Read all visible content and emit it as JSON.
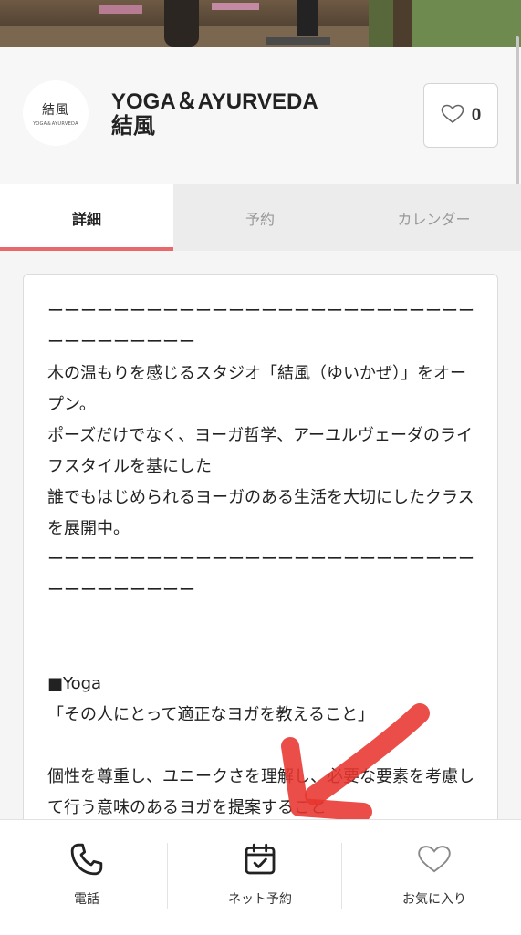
{
  "shop": {
    "logo_main": "結風",
    "logo_sub": "YOGA＆AYURVEDA",
    "title_line1": "YOGA＆AYURVEDA",
    "title_line2": "結風",
    "favorite_count": "0"
  },
  "tabs": [
    {
      "label": "詳細",
      "active": true
    },
    {
      "label": "予約",
      "active": false
    },
    {
      "label": "カレンダー",
      "active": false
    }
  ],
  "description": "ーーーーーーーーーーーーーーーーーーーーーーーーーーーーーーーーーーー\n木の温もりを感じるスタジオ「結風（ゆいかぜ）」をオープン。\nポーズだけでなく、ヨーガ哲学、アーユルヴェーダのライフスタイルを基にした\n誰でもはじめられるヨーガのある生活を大切にしたクラスを展開中。\nーーーーーーーーーーーーーーーーーーーーーーーーーーーーーーーーーーー\n\n\n■Yoga\n「その人にとって適正なヨガを教えること」\n\n個性を尊重し、ユニークさを理解し、必要な要素を考慮して行う意味のあるヨガを提案すること",
  "bottom_bar": {
    "phone_label": "電話",
    "reserve_label": "ネット予約",
    "favorite_label": "お気に入り"
  },
  "icons": {
    "heart": "heart-icon",
    "phone": "phone-icon",
    "calendar": "calendar-check-icon"
  },
  "colors": {
    "accent": "#e8696b",
    "annotation_arrow": "#e8362f"
  }
}
